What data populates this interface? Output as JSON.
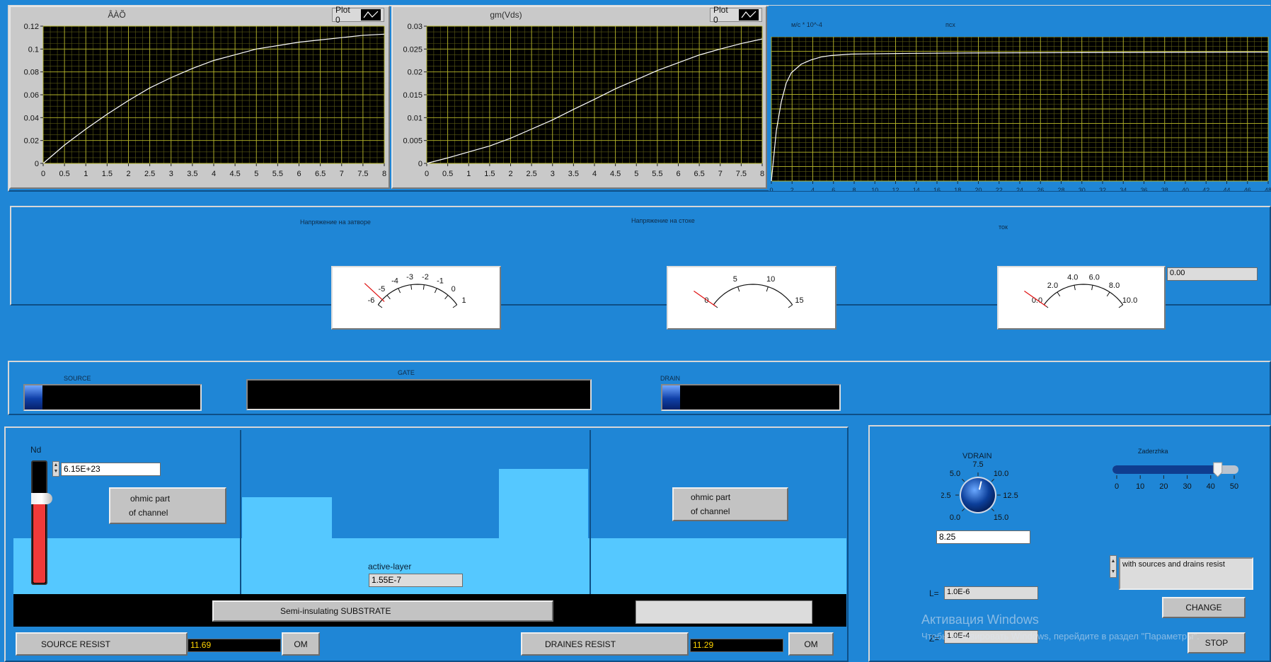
{
  "graph1": {
    "title": "ÂÀÕ",
    "plot_label": "Plot 0",
    "y_ticks": [
      "0.12",
      "0.1",
      "0.08",
      "0.06",
      "0.04",
      "0.02",
      "0"
    ],
    "x_ticks": [
      "0",
      "0.5",
      "1",
      "1.5",
      "2",
      "2.5",
      "3",
      "3.5",
      "4",
      "4.5",
      "5",
      "5.5",
      "6",
      "6.5",
      "7",
      "7.5",
      "8"
    ]
  },
  "graph2": {
    "title": "gm(Vds)",
    "plot_label": "Plot 0",
    "y_ticks": [
      "0.03",
      "0.025",
      "0.02",
      "0.015",
      "0.01",
      "0.005",
      "0"
    ],
    "x_ticks": [
      "0",
      "0.5",
      "1",
      "1.5",
      "2",
      "2.5",
      "3",
      "3.5",
      "4",
      "4.5",
      "5",
      "5.5",
      "6",
      "6.5",
      "7",
      "7.5",
      "8"
    ]
  },
  "graph3": {
    "unit_label": "м/с * 10^-4",
    "title": "псх",
    "x_ticks": [
      "0",
      "2",
      "4",
      "6",
      "8",
      "10",
      "12",
      "14",
      "16",
      "18",
      "20",
      "22",
      "24",
      "26",
      "28",
      "30",
      "32",
      "34",
      "36",
      "38",
      "40",
      "42",
      "44",
      "46",
      "48"
    ]
  },
  "chart_data": [
    {
      "type": "line",
      "title": "ÂÀÕ",
      "xlim": [
        0,
        8
      ],
      "ylim": [
        0,
        0.12
      ],
      "grid": true,
      "series": [
        {
          "name": "Plot 0",
          "x": [
            0,
            0.5,
            1,
            1.5,
            2,
            2.5,
            3,
            3.5,
            4,
            4.5,
            5,
            5.5,
            6,
            6.5,
            7,
            7.5,
            8
          ],
          "y": [
            0,
            0.016,
            0.03,
            0.043,
            0.055,
            0.066,
            0.075,
            0.083,
            0.09,
            0.095,
            0.1,
            0.103,
            0.106,
            0.108,
            0.11,
            0.112,
            0.113
          ]
        }
      ]
    },
    {
      "type": "line",
      "title": "gm(Vds)",
      "xlim": [
        0,
        8
      ],
      "ylim": [
        0,
        0.03
      ],
      "grid": true,
      "series": [
        {
          "name": "Plot 0",
          "x": [
            0,
            0.5,
            1,
            1.5,
            2,
            2.5,
            3,
            3.5,
            4,
            4.5,
            5,
            5.5,
            6,
            6.5,
            7,
            7.5,
            8
          ],
          "y": [
            0,
            0.0012,
            0.0025,
            0.0038,
            0.0055,
            0.0075,
            0.0095,
            0.0118,
            0.014,
            0.0163,
            0.0183,
            0.0203,
            0.022,
            0.0237,
            0.025,
            0.0262,
            0.0272
          ]
        }
      ]
    },
    {
      "type": "line",
      "title": "псх",
      "xlim": [
        0,
        50
      ],
      "ylim": [
        0,
        1
      ],
      "grid": true,
      "series": [
        {
          "x": [
            0,
            0.5,
            1,
            1.5,
            2,
            3,
            4,
            5,
            6,
            7,
            8,
            10,
            14,
            20,
            30,
            40,
            48,
            50
          ],
          "y": [
            0,
            0.35,
            0.55,
            0.68,
            0.75,
            0.81,
            0.84,
            0.86,
            0.87,
            0.875,
            0.88,
            0.882,
            0.885,
            0.888,
            0.89,
            0.892,
            0.893,
            0.893
          ]
        }
      ]
    }
  ],
  "gauges": {
    "gate": {
      "label": "Напряжение на затворе",
      "ticks": [
        "-6",
        "-5",
        "-4",
        "-3",
        "-2",
        "-1",
        "0",
        "1"
      ],
      "min": -6,
      "max": 1,
      "value": -5.5
    },
    "drain": {
      "label": "Напряжение на стоке",
      "ticks": [
        "0",
        "5",
        "10",
        "15"
      ],
      "min": 0,
      "max": 15,
      "value": 0
    },
    "current": {
      "label": "ток",
      "ticks": [
        "0.0",
        "2.0",
        "4.0",
        "6.0",
        "8.0",
        "10.0"
      ],
      "min": 0,
      "max": 10,
      "value": 0,
      "display": "0.00"
    }
  },
  "bars": {
    "source_label": "SOURCE",
    "gate_label": "GATE",
    "drain_label": "DRAIN",
    "source_level": 0.1,
    "drain_level": 0.1
  },
  "device": {
    "nd_label": "Nd",
    "nd_value": "6.15E+23",
    "nd_slider_level": 0.7,
    "ohmic_left_1": "ohmic part",
    "ohmic_left_2": "of channel",
    "ohmic_right_1": "ohmic part",
    "ohmic_right_2": "of channel",
    "active_label": "active-layer",
    "active_value": "1.55E-7",
    "substrate_label": "Semi-insulating SUBSTRATE",
    "source_resist_label": "SOURCE  RESIST",
    "source_resist_value": "11.69",
    "source_unit": "OM",
    "drain_resist_label": "DRAINES RESIST",
    "drain_resist_value": "11.29",
    "drain_unit": "OM"
  },
  "controls": {
    "vdrain_label": "VDRAIN",
    "vdrain_ticks": [
      "0.0",
      "2.5",
      "5.0",
      "7.5",
      "10.0",
      "12.5",
      "15.0"
    ],
    "vdrain_value": "8.25",
    "delay_label": "Zaderzhka",
    "delay_ticks": [
      "0",
      "10",
      "20",
      "30",
      "40",
      "50"
    ],
    "delay_value": 43,
    "mode_text": "with sources and drains resist",
    "l_label": "L=",
    "l_value": "1.0E-6",
    "z_label": "Z=",
    "z_value": "1.0E-4",
    "change_label": "CHANGE",
    "stop_label": "STOP"
  },
  "watermark": {
    "line1": "Активация Windows",
    "line2": "Чтобы активировать Windows, перейдите в раздел \"Параметры\"."
  },
  "colors": {
    "background": "#1f86d6",
    "plot_bg": "#000000",
    "grid_major": "#b5b52a",
    "grid_minor": "#5a5a14",
    "light_blue": "#55c8ff",
    "needle": "#e01010"
  }
}
